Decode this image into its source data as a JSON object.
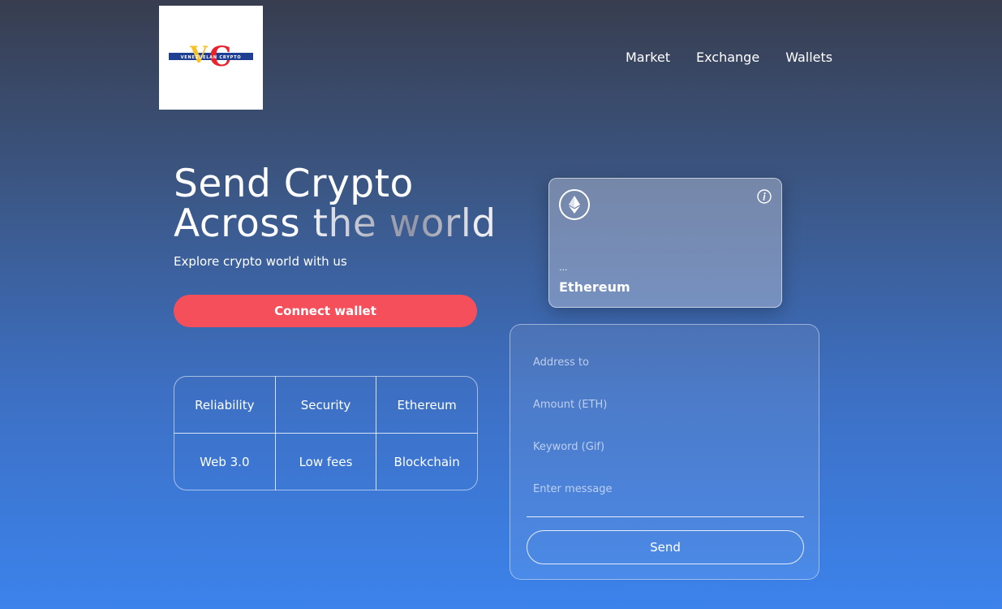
{
  "brand": {
    "logo_text": "VC",
    "logo_tagline": "VENEZUELAN CRYPTO",
    "logo_colors": {
      "v": "#f7c02b",
      "c": "#e8232d",
      "band": "#1f3f93"
    }
  },
  "nav": {
    "items": [
      {
        "label": "Market"
      },
      {
        "label": "Exchange"
      },
      {
        "label": "Wallets"
      }
    ]
  },
  "hero": {
    "title_line1": "Send Crypto",
    "title_line2": "Across the world",
    "subtitle": "Explore crypto world with us",
    "connect_label": "Connect wallet"
  },
  "features": [
    {
      "label": "Reliability"
    },
    {
      "label": "Security"
    },
    {
      "label": "Ethereum"
    },
    {
      "label": "Web 3.0"
    },
    {
      "label": "Low fees"
    },
    {
      "label": "Blockchain"
    }
  ],
  "card": {
    "icon": "ethereum-icon",
    "info_icon": "info-icon",
    "address": "...",
    "name": "Ethereum"
  },
  "form": {
    "address_placeholder": "Address to",
    "amount_placeholder": "Amount (ETH)",
    "keyword_placeholder": "Keyword (Gif)",
    "message_placeholder": "Enter message",
    "send_label": "Send"
  },
  "colors": {
    "accent": "#f54f5c",
    "background_top": "#383d4f",
    "background_bottom": "#3c83ec"
  }
}
